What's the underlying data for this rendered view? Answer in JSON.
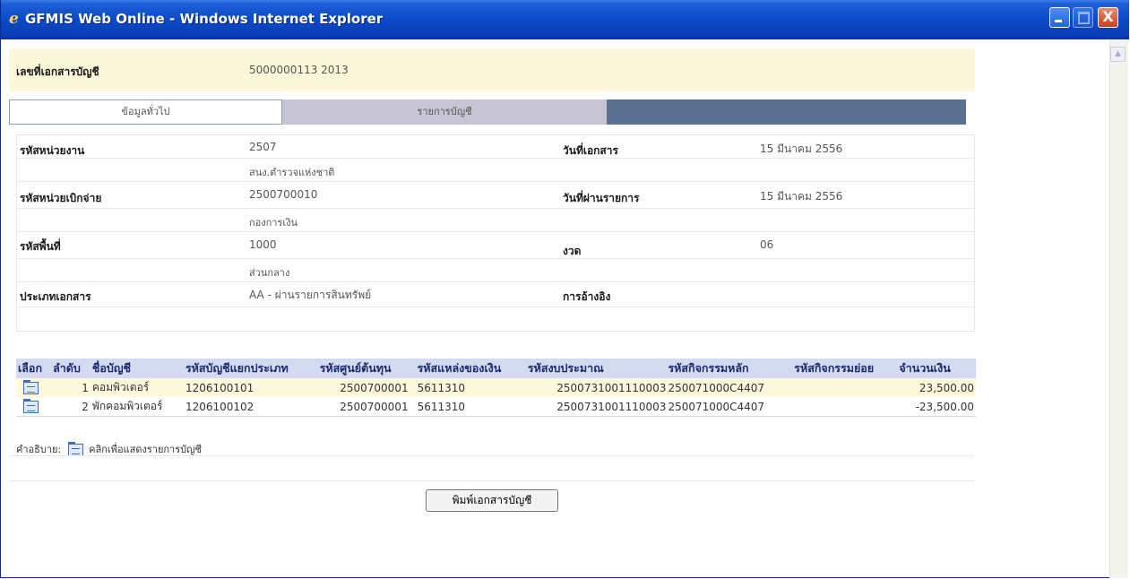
{
  "window": {
    "title": "GFMIS Web Online - Windows Internet Explorer",
    "close_glyph": "X"
  },
  "header": {
    "doc_no_label": "เลขที่เอกสารบัญชี",
    "doc_no_value": "5000000113  2013"
  },
  "tabs": [
    {
      "label": "ข้อมูลทั่วไป",
      "active": true
    },
    {
      "label": "รายการบัญชี",
      "active": false
    }
  ],
  "info": {
    "agency_label": "รหัสหน่วยงาน",
    "agency_code": "2507",
    "agency_name": "สนง.ตำรวจแห่งชาติ",
    "disb_label": "รหัสหน่วยเบิกจ่าย",
    "disb_code": "2500700010",
    "disb_name": "กองการเงิน",
    "area_label": "รหัสพื้นที่",
    "area_code": "1000",
    "area_name": "ส่วนกลาง",
    "doctype_label": "ประเภทเอกสาร",
    "doctype_value": "AA - ผ่านรายการสินทรัพย์",
    "docdate_label": "วันที่เอกสาร",
    "docdate_value": "15 มีนาคม 2556",
    "postdate_label": "วันที่ผ่านรายการ",
    "postdate_value": "15 มีนาคม 2556",
    "period_label": "งวด",
    "period_value": "06",
    "ref_label": "การอ้างอิง",
    "ref_value": ""
  },
  "table": {
    "headers": [
      "เลือก",
      "ลำดับ",
      "ชื่อบัญชี",
      "รหัสบัญชีแยกประเภท",
      "รหัสศูนย์ต้นทุน",
      "รหัสแหล่งของเงิน",
      "รหัสงบประมาณ",
      "รหัสกิจกรรมหลัก",
      "รหัสกิจกรรมย่อย",
      "จำนวนเงิน"
    ],
    "rows": [
      {
        "seq": "1",
        "name": "คอมพิวเตอร์",
        "gl": "1206100101",
        "cost_center": "2500700001",
        "fund": "5611310",
        "budget": "2500731001110003",
        "main_act": "250071000C4407",
        "sub_act": "",
        "amount": "23,500.00"
      },
      {
        "seq": "2",
        "name": "พักคอมพิวเตอร์",
        "gl": "1206100102",
        "cost_center": "2500700001",
        "fund": "5611310",
        "budget": "2500731001110003",
        "main_act": "250071000C4407",
        "sub_act": "",
        "amount": "-23,500.00"
      }
    ]
  },
  "legend": {
    "prefix": "คำอธิบาย:",
    "text": "คลิกเพื่อแสดงรายการบัญชี"
  },
  "print_button": "พิมพ์เอกสารบัญชี",
  "colors": {
    "titlebar": "#0a49c8",
    "header_band": "#fbf7d9",
    "tab_bar": "#5b718f",
    "table_header": "#d4daf0"
  }
}
